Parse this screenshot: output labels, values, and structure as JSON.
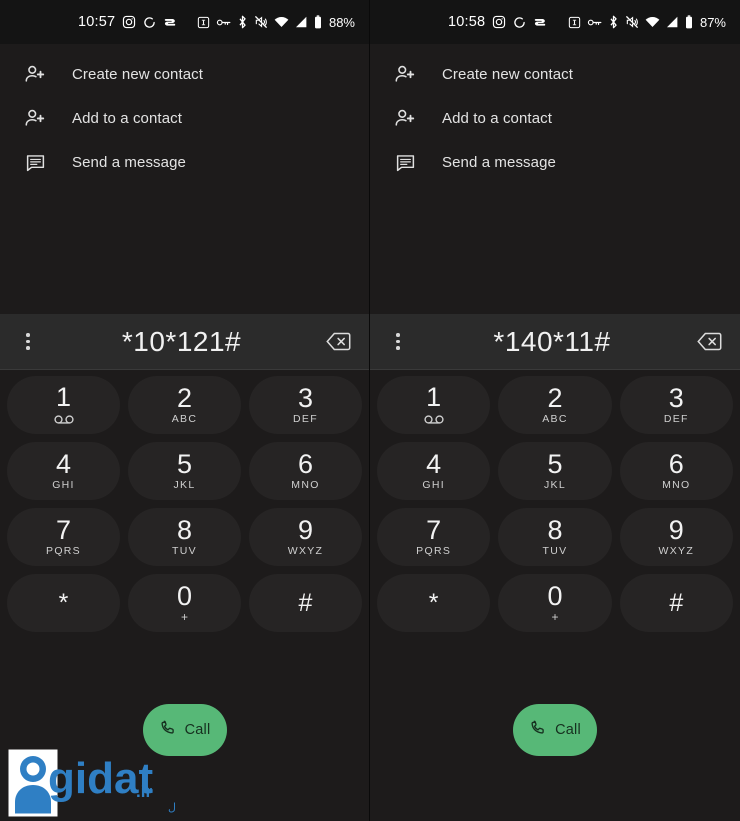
{
  "panels": [
    {
      "id": "left",
      "status": {
        "clock": "10:57",
        "battery": "88%",
        "left_icons": [
          "instagram-icon",
          "sync-circle-icon",
          "app-badge-icon"
        ],
        "right_icons": [
          "screen-record-icon",
          "vpn-key-icon",
          "bluetooth-icon",
          "ringer-muted-icon",
          "wifi-icon",
          "signal-icon",
          "battery-icon"
        ]
      },
      "menu": [
        {
          "icon": "person-add-icon",
          "label": "Create new contact"
        },
        {
          "icon": "person-add-icon",
          "label": "Add to a contact"
        },
        {
          "icon": "message-icon",
          "label": "Send a message"
        }
      ],
      "dial": {
        "number": "*10*121#",
        "overflow_icon": "overflow-menu-icon",
        "backspace_icon": "backspace-icon"
      },
      "call": {
        "label": "Call",
        "icon": "phone-icon"
      },
      "watermark": {
        "brand": "gidat",
        "tld": ".ir",
        "tagline": "مقاله فارسی · فروشگاه دیجیتال"
      }
    },
    {
      "id": "right",
      "status": {
        "clock": "10:58",
        "battery": "87%",
        "left_icons": [
          "instagram-icon",
          "sync-circle-icon",
          "app-badge-icon"
        ],
        "right_icons": [
          "screen-record-icon",
          "vpn-key-icon",
          "bluetooth-icon",
          "ringer-muted-icon",
          "wifi-icon",
          "signal-icon",
          "battery-icon"
        ]
      },
      "menu": [
        {
          "icon": "person-add-icon",
          "label": "Create new contact"
        },
        {
          "icon": "person-add-icon",
          "label": "Add to a contact"
        },
        {
          "icon": "message-icon",
          "label": "Send a message"
        }
      ],
      "dial": {
        "number": "*140*11#",
        "overflow_icon": "overflow-menu-icon",
        "backspace_icon": "backspace-icon"
      },
      "call": {
        "label": "Call",
        "icon": "phone-icon"
      },
      "watermark": null
    }
  ],
  "keypad": {
    "rows": [
      [
        {
          "digit": "1",
          "sub": "",
          "sub_type": "voicemail"
        },
        {
          "digit": "2",
          "sub": "ABC",
          "sub_type": "letters"
        },
        {
          "digit": "3",
          "sub": "DEF",
          "sub_type": "letters"
        }
      ],
      [
        {
          "digit": "4",
          "sub": "GHI",
          "sub_type": "letters"
        },
        {
          "digit": "5",
          "sub": "JKL",
          "sub_type": "letters"
        },
        {
          "digit": "6",
          "sub": "MNO",
          "sub_type": "letters"
        }
      ],
      [
        {
          "digit": "7",
          "sub": "PQRS",
          "sub_type": "letters"
        },
        {
          "digit": "8",
          "sub": "TUV",
          "sub_type": "letters"
        },
        {
          "digit": "9",
          "sub": "WXYZ",
          "sub_type": "letters"
        }
      ],
      [
        {
          "digit": "*",
          "sub": "",
          "sub_type": "none"
        },
        {
          "digit": "0",
          "sub": "+",
          "sub_type": "plus"
        },
        {
          "digit": "#",
          "sub": "",
          "sub_type": "none"
        }
      ]
    ]
  },
  "colors": {
    "background": "#1d1b1b",
    "statusbar": "#141414",
    "dialbar": "#2b2b2b",
    "key": "#262424",
    "call_green": "#57b877",
    "text_primary": "#f2f2f2",
    "text_secondary": "#cfcfcf",
    "watermark_blue": "#2f7fc4"
  }
}
